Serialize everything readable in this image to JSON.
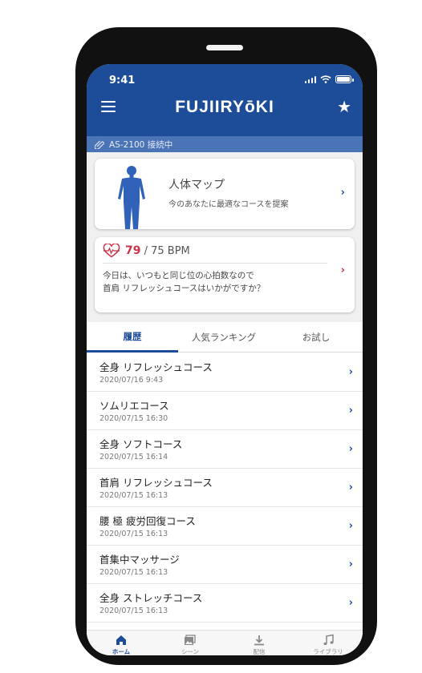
{
  "status": {
    "time": "9:41"
  },
  "header": {
    "logo": "FUJIIRYōKI"
  },
  "connection": {
    "text": "AS-2100 接続中"
  },
  "body_map": {
    "title": "人体マップ",
    "subtitle": "今のあなたに最適なコースを提案"
  },
  "heart": {
    "current": "79",
    "rest": " / 75 BPM",
    "message_line1": "今日は、いつもと同じ位の心拍数なので",
    "message_line2": "首肩 リフレッシュコースはいかがですか？"
  },
  "tabs": [
    {
      "label": "履歴"
    },
    {
      "label": "人気ランキング"
    },
    {
      "label": "お試し"
    }
  ],
  "history": [
    {
      "title": "全身 リフレッシュコース",
      "date": "2020/07/16 9:43"
    },
    {
      "title": "ソムリエコース",
      "date": "2020/07/15 16:30"
    },
    {
      "title": "全身 ソフトコース",
      "date": "2020/07/15 16:14"
    },
    {
      "title": "首肩 リフレッシュコース",
      "date": "2020/07/15 16:13"
    },
    {
      "title": "腰 極 疲労回復コース",
      "date": "2020/07/15 16:13"
    },
    {
      "title": "首集中マッサージ",
      "date": "2020/07/15 16:13"
    },
    {
      "title": "全身 ストレッチコース",
      "date": "2020/07/15 16:13"
    }
  ],
  "nav": [
    {
      "label": "ホーム",
      "icon": "home-icon"
    },
    {
      "label": "シーン",
      "icon": "image-icon"
    },
    {
      "label": "配信",
      "icon": "download-icon"
    },
    {
      "label": "ライブラリ",
      "icon": "music-icon"
    }
  ],
  "colors": {
    "primary": "#1d4c99",
    "accent": "#c8334a",
    "conn_bar": "#4a74b6"
  }
}
